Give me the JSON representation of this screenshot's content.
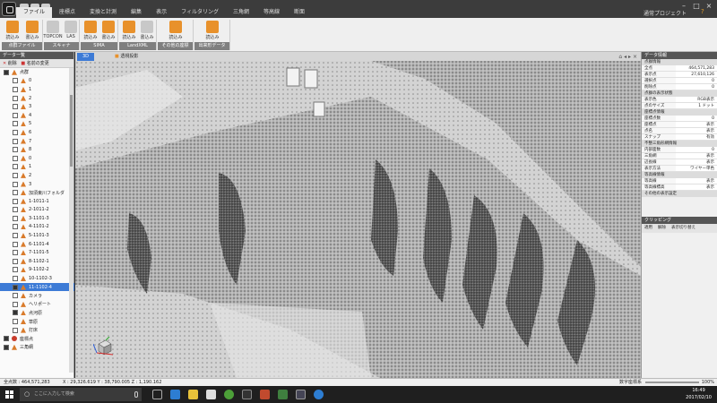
{
  "menu": {
    "items": [
      "ファイル",
      "座標点",
      "変換と計測",
      "編集",
      "表示",
      "フィルタリング",
      "三角網",
      "等高線",
      "断面"
    ],
    "active_index": 0,
    "project": "通常プロジェクト"
  },
  "ribbon": {
    "groups": [
      {
        "label": "点群ファイル",
        "buttons": [
          {
            "label": "読込み",
            "icon": "txt-file-icon"
          },
          {
            "label": "書込み",
            "icon": "txt-file-icon"
          }
        ]
      },
      {
        "label": "スキャナ",
        "buttons": [
          {
            "label": "TOPCON",
            "icon": "scanner-icon"
          },
          {
            "label": "LAS",
            "icon": "las-file-icon"
          }
        ]
      },
      {
        "label": "SIMA",
        "buttons": [
          {
            "label": "読込み",
            "icon": "sima-file-icon"
          },
          {
            "label": "書込み",
            "icon": "sima-file-icon"
          }
        ]
      },
      {
        "label": "LandXML",
        "buttons": [
          {
            "label": "読込み",
            "icon": "xml-file-icon"
          },
          {
            "label": "書込み",
            "icon": "xml-file-icon"
          }
        ]
      },
      {
        "label": "その他の座標",
        "buttons": [
          {
            "label": "読込み",
            "icon": "xml-file-icon"
          }
        ]
      },
      {
        "label": "出来形データ",
        "buttons": [
          {
            "label": "読込み",
            "icon": "xml-file-icon"
          }
        ]
      }
    ]
  },
  "left_panel": {
    "title": "データ一覧",
    "tools": [
      "削除",
      "名前の変更"
    ],
    "items": [
      {
        "label": "点群",
        "checked": true,
        "icon": "pointcloud-icon",
        "selected": false
      },
      {
        "label": "0",
        "checked": false,
        "icon": "pointcloud-icon",
        "selected": false
      },
      {
        "label": "1",
        "checked": false,
        "icon": "pointcloud-icon",
        "selected": false
      },
      {
        "label": "2",
        "checked": false,
        "icon": "pointcloud-icon",
        "selected": false
      },
      {
        "label": "3",
        "checked": false,
        "icon": "pointcloud-icon",
        "selected": false
      },
      {
        "label": "4",
        "checked": false,
        "icon": "pointcloud-icon",
        "selected": false
      },
      {
        "label": "5",
        "checked": false,
        "icon": "pointcloud-icon",
        "selected": false
      },
      {
        "label": "6",
        "checked": false,
        "icon": "pointcloud-icon",
        "selected": false
      },
      {
        "label": "7",
        "checked": false,
        "icon": "pointcloud-icon",
        "selected": false
      },
      {
        "label": "8",
        "checked": false,
        "icon": "pointcloud-icon",
        "selected": false
      },
      {
        "label": "0",
        "checked": false,
        "icon": "pointcloud-icon",
        "selected": false
      },
      {
        "label": "1",
        "checked": false,
        "icon": "pointcloud-icon",
        "selected": false
      },
      {
        "label": "2",
        "checked": false,
        "icon": "pointcloud-icon",
        "selected": false
      },
      {
        "label": "3",
        "checked": false,
        "icon": "pointcloud-icon",
        "selected": false
      },
      {
        "label": "加須東川フォルダ",
        "checked": false,
        "icon": "pointcloud-icon",
        "selected": false
      },
      {
        "label": "1-1011-1",
        "checked": false,
        "icon": "pointcloud-icon",
        "selected": false
      },
      {
        "label": "2-1011-2",
        "checked": false,
        "icon": "pointcloud-icon",
        "selected": false
      },
      {
        "label": "3-1101-3",
        "checked": false,
        "icon": "pointcloud-icon",
        "selected": false
      },
      {
        "label": "4-1101-2",
        "checked": false,
        "icon": "pointcloud-icon",
        "selected": false
      },
      {
        "label": "5-1101-3",
        "checked": false,
        "icon": "pointcloud-icon",
        "selected": false
      },
      {
        "label": "6-1101-4",
        "checked": false,
        "icon": "pointcloud-icon",
        "selected": false
      },
      {
        "label": "7-1101-5",
        "checked": false,
        "icon": "pointcloud-icon",
        "selected": false
      },
      {
        "label": "8-1102-1",
        "checked": false,
        "icon": "pointcloud-icon",
        "selected": false
      },
      {
        "label": "9-1102-2",
        "checked": false,
        "icon": "pointcloud-icon",
        "selected": false
      },
      {
        "label": "10-1102-3",
        "checked": false,
        "icon": "pointcloud-icon",
        "selected": false
      },
      {
        "label": "11-1102-4",
        "checked": true,
        "icon": "pointcloud-icon",
        "selected": true
      },
      {
        "label": "カメラ",
        "checked": false,
        "icon": "pointcloud-icon",
        "selected": false
      },
      {
        "label": "ヘリポート",
        "checked": false,
        "icon": "pointcloud-icon",
        "selected": false
      },
      {
        "label": "点河原",
        "checked": true,
        "icon": "pointcloud-icon",
        "selected": false
      },
      {
        "label": "草原",
        "checked": false,
        "icon": "pointcloud-icon",
        "selected": false
      },
      {
        "label": "打床",
        "checked": false,
        "icon": "pointcloud-icon",
        "selected": false
      },
      {
        "label": "座標点",
        "checked": true,
        "icon": "pin-icon",
        "selected": false
      },
      {
        "label": "三角網",
        "checked": true,
        "icon": "tin-icon",
        "selected": false
      }
    ]
  },
  "viewport": {
    "tabs": [
      "3D",
      "透視投影"
    ],
    "active_tab": 0
  },
  "right_panel": {
    "title": "データ情報",
    "sections": [
      {
        "title": "点群情報",
        "rows": [
          [
            "全点",
            "464,571,283"
          ],
          [
            "表示点",
            "27,610,126"
          ],
          [
            "選択点",
            "0"
          ],
          [
            "削除点",
            "0"
          ]
        ]
      },
      {
        "title": "点群の表示状態",
        "rows": [
          [
            "表示色",
            "RGB表示"
          ],
          [
            "点のサイズ",
            "1 ドット"
          ]
        ]
      },
      {
        "title": "座標点情報",
        "rows": [
          [
            "座標点数",
            "0"
          ],
          [
            "座標点",
            "表示"
          ],
          [
            "点名",
            "表示"
          ],
          [
            "スナップ",
            "有効"
          ]
        ]
      },
      {
        "title": "不整三角形網情報",
        "rows": [
          [
            "内部面数",
            "0"
          ],
          [
            "三角網",
            "表示"
          ],
          [
            "辺長線",
            "表示"
          ],
          [
            "表示方法",
            "ワイヤー単色"
          ]
        ]
      },
      {
        "title": "等高線情報",
        "rows": [
          [
            "等高線",
            "表示"
          ],
          [
            "等高線標高",
            "表示"
          ]
        ]
      },
      {
        "title": "その他の表示設定",
        "rows": []
      }
    ],
    "clip_title": "クリッピング",
    "clip_tools": [
      "適用",
      "解除",
      "表示切り替え"
    ]
  },
  "status": {
    "point_count_label": "全点数 : 464,571,283",
    "coords": "X : 29,326.619  Y : 38,790.005  Z : 1,190.162",
    "coord_system": "数字座標系",
    "zoom": "100%"
  },
  "taskbar": {
    "search_placeholder": "ここに入力して検索",
    "time": "16:49",
    "date": "2017/02/10"
  },
  "colors": {
    "accent": "#3d7bd6",
    "ribbon_icon": "#e8912b",
    "titlebar": "#3c3c3c"
  }
}
